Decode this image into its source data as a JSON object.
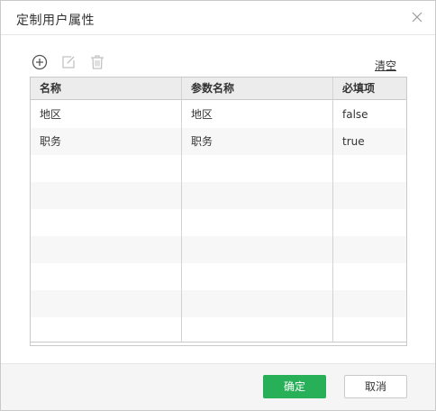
{
  "dialog": {
    "title": "定制用户属性",
    "clear_label": "清空"
  },
  "toolbar": {
    "icons": [
      "add-icon",
      "edit-icon",
      "delete-icon"
    ]
  },
  "table": {
    "columns": [
      "名称",
      "参数名称",
      "必填项"
    ],
    "rows": [
      {
        "name": "地区",
        "param": "地区",
        "required": "false"
      },
      {
        "name": "职务",
        "param": "职务",
        "required": "true"
      }
    ]
  },
  "footer": {
    "ok_label": "确定",
    "cancel_label": "取消"
  },
  "colors": {
    "accent": "#27b058",
    "header_bg": "#ececec",
    "footer_bg": "#f5f5f5",
    "border": "#c9c9c9"
  }
}
